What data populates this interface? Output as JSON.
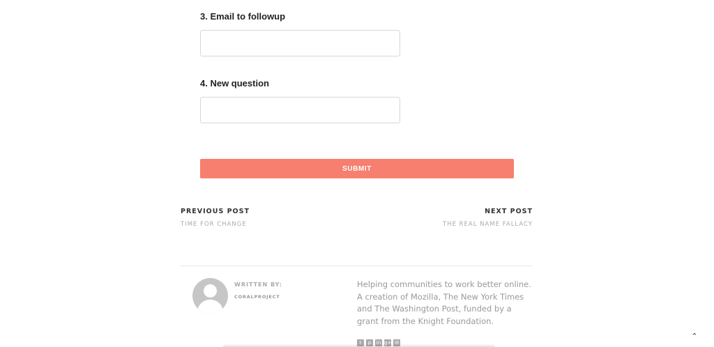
{
  "form": {
    "questions": [
      {
        "label": "3. Email to followup",
        "value": "",
        "placeholder": ""
      },
      {
        "label": "4. New question",
        "value": "",
        "placeholder": ""
      }
    ],
    "submit_label": "SUBMIT"
  },
  "post_nav": {
    "previous": {
      "heading": "PREVIOUS POST",
      "title": "TIME FOR CHANGE"
    },
    "next": {
      "heading": "NEXT POST",
      "title": "THE REAL NAME FALLACY"
    }
  },
  "author": {
    "written_by_label": "WRITTEN BY:",
    "name": "CORALPROJECT",
    "bio": "Helping communities to work better online. A creation of Mozilla, The New York Times and The Washington Post, funded by a grant from the Knight Foundation.",
    "socials": [
      {
        "icon": "twitter-icon",
        "glyph": "t"
      },
      {
        "icon": "pinterest-icon",
        "glyph": "p"
      },
      {
        "icon": "linkedin-icon",
        "glyph": "in"
      },
      {
        "icon": "google-plus-icon",
        "glyph": "g+"
      },
      {
        "icon": "mail-icon",
        "glyph": "✉"
      }
    ]
  },
  "scroll_top": {
    "icon": "chevron-up-icon",
    "glyph": "⌃"
  },
  "colors": {
    "accent": "#f67f6f",
    "muted_text": "#999999"
  }
}
